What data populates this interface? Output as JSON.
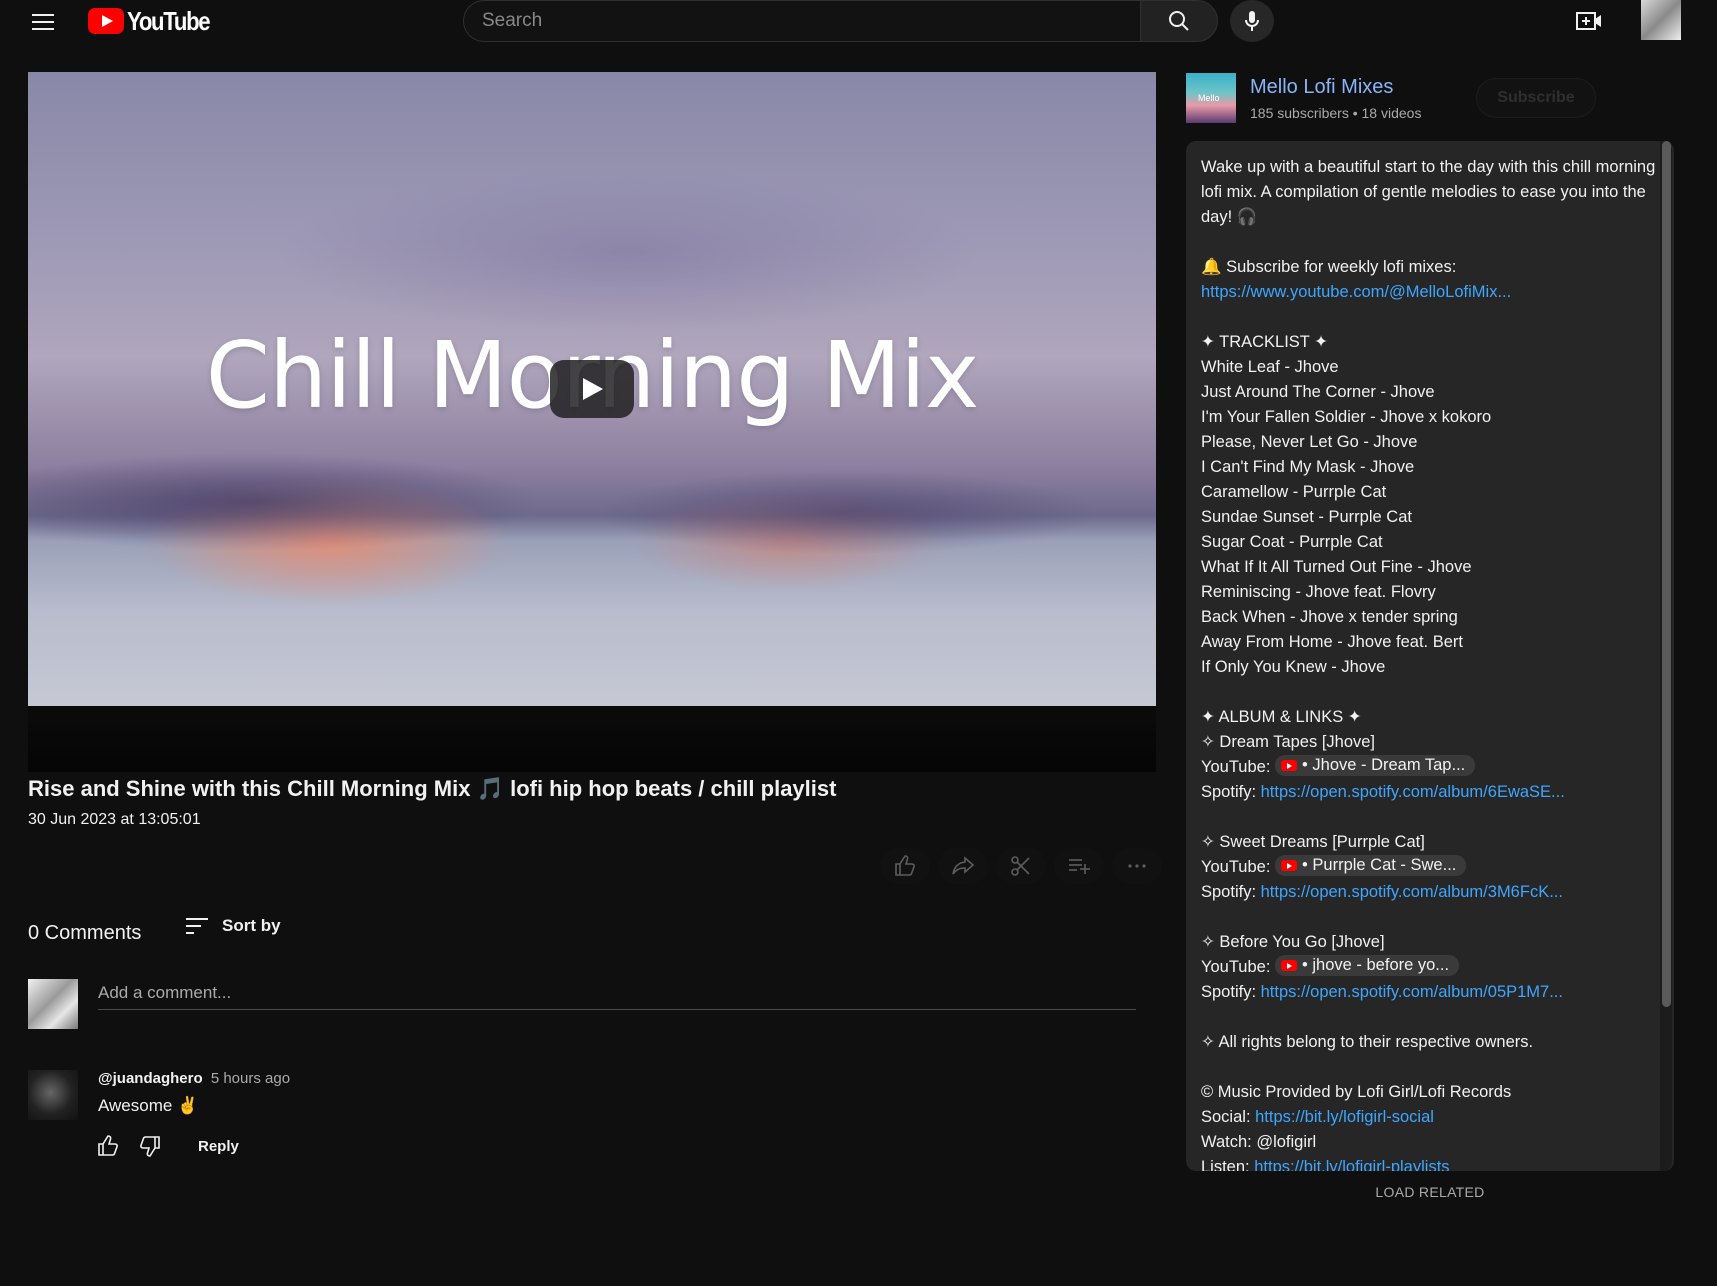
{
  "header": {
    "search_placeholder": "Search",
    "logo_text": "YouTube",
    "icons": [
      "menu-icon",
      "search-icon",
      "mic-icon",
      "create-video-icon"
    ]
  },
  "video": {
    "thumbnail_text": "Chill Morning Mix",
    "title": "Rise and Shine with this Chill Morning Mix 🎵 lofi hip hop beats / chill playlist",
    "date": "30 Jun 2023 at 13:05:01"
  },
  "actions": [
    "like-icon",
    "share-icon",
    "clip-icon",
    "save-icon",
    "more-icon"
  ],
  "comments": {
    "count_label": "0 Comments",
    "sort_label": "Sort by",
    "add_placeholder": "Add a comment...",
    "items": [
      {
        "author": "@juandaghero",
        "time": "5 hours ago",
        "text": "Awesome ✌️",
        "reply_label": "Reply"
      }
    ]
  },
  "channel": {
    "avatar_text": "Mello",
    "name": "Mello Lofi Mixes",
    "meta": "185 subscribers • 18 videos",
    "subscribe_label": "Subscribe"
  },
  "description": {
    "intro": "Wake up with a beautiful start to the day with this chill morning lofi mix. A compilation of gentle melodies to ease you into the day! 🎧",
    "subscribe_line": "🔔 Subscribe for weekly lofi mixes:",
    "subscribe_link": "https://www.youtube.com/@MelloLofiMix...",
    "tracklist_header": "✦ TRACKLIST ✦",
    "tracks": [
      "White Leaf - Jhove",
      "Just Around The Corner - Jhove",
      "I'm Your Fallen Soldier - Jhove x kokoro",
      "Please, Never Let Go - Jhove",
      "I Can't Find My Mask - Jhove",
      "Caramellow - Purrple Cat",
      "Sundae Sunset - Purrple Cat",
      "Sugar Coat - Purrple Cat",
      "What If It All Turned Out Fine - Jhove",
      "Reminiscing - Jhove feat. Flovry",
      "Back When - Jhove x tender spring",
      "Away From Home - Jhove feat. Bert",
      "If Only You Knew - Jhove"
    ],
    "albums_header": "✦ ALBUM & LINKS ✦",
    "youtube_label": "YouTube:",
    "spotify_label": "Spotify:",
    "albums": [
      {
        "name": "✧ Dream Tapes [Jhove]",
        "youtube_chip": "• Jhove - Dream Tap...",
        "spotify_link": "https://open.spotify.com/album/6EwaSE..."
      },
      {
        "name": "✧ Sweet Dreams [Purrple Cat]",
        "youtube_chip": "• Purrple Cat - Swe...",
        "spotify_link": "https://open.spotify.com/album/3M6FcK..."
      },
      {
        "name": "✧ Before You Go [Jhove]",
        "youtube_chip": "• jhove - before yo...",
        "spotify_link": "https://open.spotify.com/album/05P1M7..."
      }
    ],
    "rights": "✧ All rights belong to their respective owners.",
    "credits": "© Music Provided by Lofi Girl/Lofi Records",
    "social_label": "Social:",
    "social_link": "https://bit.ly/lofigirl-social",
    "watch_line": "Watch: @lofigirl",
    "listen_label": "Listen:",
    "listen_link": "https://bit.ly/lofigirl-playlists"
  },
  "load_related_label": "LOAD RELATED",
  "colors": {
    "background": "#0f0f0f",
    "link": "#3ea6ff",
    "channel_name": "#8ab4f8",
    "brand_red": "#ff0000"
  }
}
